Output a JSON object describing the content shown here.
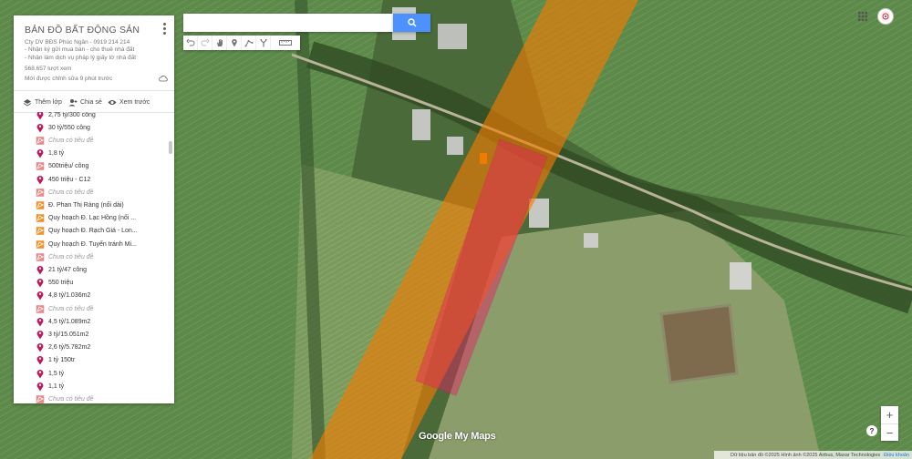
{
  "map": {
    "logo_text": "Google My Maps",
    "attribution": "Dữ liệu bản đồ ©2025 Hình ảnh ©2025 Airbus, Maxar Technologies",
    "terms_link": "Điều khoản",
    "zoom_in": "+",
    "zoom_out": "−",
    "help": "?"
  },
  "panel": {
    "title": "BẢN ĐỒ BẤT ĐỘNG SẢN",
    "description_lines": [
      "Cty DV BĐS Phúc Ngân - 0919 214 214",
      "- Nhận ký gửi mua bán - cho thuê nhà đất",
      "- Nhận làm dịch vụ pháp lý giấy tờ nhà đất"
    ],
    "views": "568.657 lượt xem",
    "last_edit": "Mới được chỉnh sửa 9 phút trước",
    "actions": {
      "add_layer": "Thêm lớp",
      "share": "Chia sẻ",
      "preview": "Xem trước"
    },
    "items": [
      {
        "label": "2,75 tỷ/300 công",
        "type": "pin"
      },
      {
        "label": "30 tỷ/550 công",
        "type": "pin"
      },
      {
        "label": "Chưa có tiêu đề",
        "type": "polygon-pink"
      },
      {
        "label": "1,8 tỷ",
        "type": "pin"
      },
      {
        "label": "500triệu/ công",
        "type": "polygon-pink"
      },
      {
        "label": "450 triệu - C12",
        "type": "pin"
      },
      {
        "label": "Chưa có tiêu đề",
        "type": "polygon-pink"
      },
      {
        "label": "Đ. Phan Thị Ràng (nối dài)",
        "type": "polygon-orange"
      },
      {
        "label": "Quy hoạch Đ. Lạc Hồng (nối ...",
        "type": "polygon-orange"
      },
      {
        "label": "Quy hoạch Đ. Rạch Giá - Lon...",
        "type": "polygon-orange"
      },
      {
        "label": "Quy hoạch Đ. Tuyến tránh Mi...",
        "type": "polygon-orange"
      },
      {
        "label": "Chưa có tiêu đề",
        "type": "polygon-pink"
      },
      {
        "label": "21 tỷ/47 công",
        "type": "pin"
      },
      {
        "label": "550 triệu",
        "type": "pin"
      },
      {
        "label": "4,8 tỷ/1.036m2",
        "type": "pin"
      },
      {
        "label": "Chưa có tiêu đề",
        "type": "polygon-pink"
      },
      {
        "label": "4,5 tỷ/1.089m2",
        "type": "pin"
      },
      {
        "label": "3 tỷ/15.051m2",
        "type": "pin"
      },
      {
        "label": "2,6 tỷ/5.782m2",
        "type": "pin"
      },
      {
        "label": "1 tỷ 150tr",
        "type": "pin"
      },
      {
        "label": "1,5 tỷ",
        "type": "pin"
      },
      {
        "label": "1,1 tỷ",
        "type": "pin"
      },
      {
        "label": "Chưa có tiêu đề",
        "type": "polygon-pink"
      }
    ]
  },
  "search": {
    "placeholder": ""
  },
  "toolbar": {
    "tools": [
      "undo-icon",
      "redo-icon",
      "hand-icon",
      "marker-icon",
      "draw-line-icon",
      "directions-icon",
      "ruler-icon"
    ]
  },
  "colors": {
    "pin": "#c2185b",
    "polygon_pink": "#e57373",
    "polygon_orange": "#f57c00",
    "search_button": "#4d90fe",
    "untitled_text": "#9a9a9a"
  }
}
